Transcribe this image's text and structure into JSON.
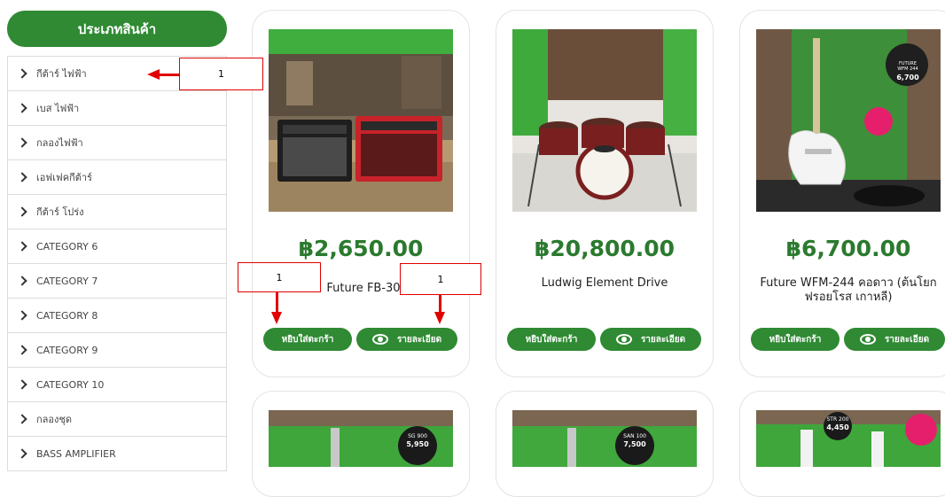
{
  "sidebar": {
    "title": "ประเภทสินค้า",
    "items": [
      {
        "label": "กีต้าร์ ไฟฟ้า"
      },
      {
        "label": "เบส ไฟฟ้า"
      },
      {
        "label": "กลองไฟฟ้า"
      },
      {
        "label": "เอฟเฟคกีต้าร์"
      },
      {
        "label": "กีต้าร์ โปร่ง"
      },
      {
        "label": "CATEGORY 6"
      },
      {
        "label": "CATEGORY 7"
      },
      {
        "label": "CATEGORY 8"
      },
      {
        "label": "CATEGORY 9"
      },
      {
        "label": "CATEGORY 10"
      },
      {
        "label": "กลองชุด"
      },
      {
        "label": "BASS AMPLIFIER"
      }
    ]
  },
  "products": [
    {
      "price": "฿2,650.00",
      "name": "Future FB-30",
      "add_label": "หยิบใส่ตะกร้า",
      "detail_label": "รายละเอียด"
    },
    {
      "price": "฿20,800.00",
      "name": "Ludwig Element Drive",
      "add_label": "หยิบใส่ตะกร้า",
      "detail_label": "รายละเอียด"
    },
    {
      "price": "฿6,700.00",
      "name": "Future WFM-244 คอดาว (ต้นโยกฟรอยโรส เกาหลี)",
      "add_label": "หยิบใส่ตะกร้า",
      "detail_label": "รายละเอียด"
    }
  ],
  "image_texts": {
    "p3_tag_top": "FUTURE WFM 244",
    "p3_tag_price": "6,700",
    "r1_tag_top": "SG 900",
    "r1_tag_price": "5,950",
    "r2_tag_top": "SAN 100",
    "r2_tag_price": "7,500",
    "r3_tag_top": "STR 200",
    "r3_tag_price": "4,450"
  },
  "annotations": [
    {
      "label": "1"
    },
    {
      "label": "1"
    },
    {
      "label": "1"
    }
  ],
  "colors": {
    "accent": "#2f8a33",
    "price": "#2b7a2f",
    "annotation": "#e00000"
  }
}
